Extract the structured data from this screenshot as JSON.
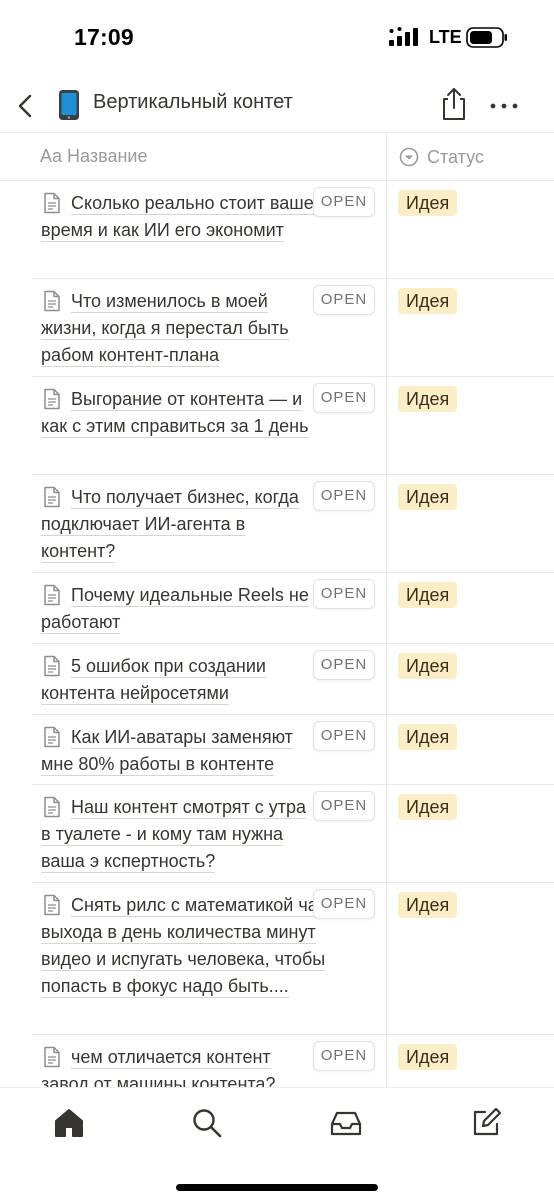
{
  "status_bar": {
    "time": "17:09",
    "network": "LTE"
  },
  "header": {
    "page_icon": "mobile-phone-emoji",
    "title": "Вертикальный контет"
  },
  "table": {
    "columns": {
      "name_icon": "Aa",
      "name": "Название",
      "status": "Статус"
    },
    "rows": [
      {
        "title": "Сколько реально стоит ваше время и как ИИ его экономит",
        "open": "OPEN",
        "status": "Идея"
      },
      {
        "title": "Что изменилось в моей жизни, когда я перестал быть рабом контент-плана",
        "open": "OPEN",
        "status": "Идея"
      },
      {
        "title": "Выгорание от контента — и как с этим справиться за 1 день",
        "open": "OPEN",
        "status": "Идея"
      },
      {
        "title": "Что получает бизнес, когда подключает ИИ-агента в контент?",
        "open": "OPEN",
        "status": "Идея"
      },
      {
        "title": "Почему идеальные Reels не работают",
        "open": "OPEN",
        "status": "Идея"
      },
      {
        "title": "5 ошибок при создании контента нейросетями",
        "open": "OPEN",
        "status": "Идея"
      },
      {
        "title": "Как ИИ-аватары заменяют мне 80% работы в контенте",
        "open": "OPEN",
        "status": "Идея"
      },
      {
        "title": "Наш контент смотрят с утра в туалете - и кому там нужна ваша э кспертность?",
        "open": "OPEN",
        "status": "Идея"
      },
      {
        "title": "Снять рилс с математикой часов, выхода в день количества минут видео и испугать человека, чтобы попасть в фокус надо быть....",
        "open": "OPEN",
        "status": "Идея"
      },
      {
        "title": "чем отличается контент завод от машины контента?",
        "open": "OPEN",
        "status": "Идея"
      }
    ]
  },
  "bottom_nav": {
    "items": [
      "home-icon",
      "search-icon",
      "inbox-icon",
      "new-page-icon"
    ]
  },
  "colors": {
    "status_tag_bg": "#fbedc6",
    "status_tag_text": "#402c1b",
    "text": "#37352f",
    "muted": "#9b9a97"
  }
}
